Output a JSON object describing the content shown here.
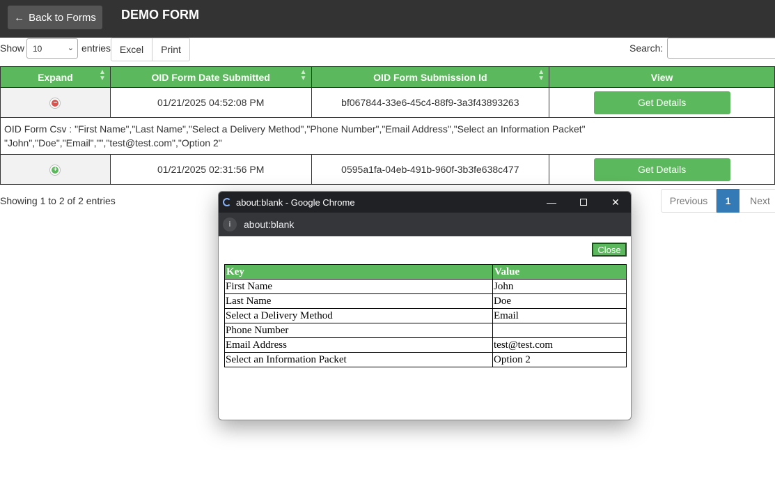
{
  "header": {
    "back_label": "Back to Forms",
    "title": "DEMO FORM"
  },
  "controls": {
    "show_label": "Show",
    "page_length": "10",
    "entries_label": "entries",
    "excel_label": "Excel",
    "print_label": "Print",
    "search_label": "Search:",
    "search_value": ""
  },
  "table": {
    "columns": [
      "Expand",
      "OID Form Date Submitted",
      "OID Form Submission Id",
      "View"
    ],
    "rows": [
      {
        "date": "01/21/2025 04:52:08 PM",
        "id": "bf067844-33e6-45c4-88f9-3a3f43893263",
        "button": "Get Details",
        "expanded": true,
        "csv_line1": "OID Form Csv : \"First Name\",\"Last Name\",\"Select a Delivery Method\",\"Phone Number\",\"Email Address\",\"Select an Information Packet\"",
        "csv_line2": "\"John\",\"Doe\",\"Email\",\"\",\"test@test.com\",\"Option 2\""
      },
      {
        "date": "01/21/2025 02:31:56 PM",
        "id": "0595a1fa-04eb-491b-960f-3b3fe638c477",
        "button": "Get Details",
        "expanded": false
      }
    ]
  },
  "footer": {
    "info": "Showing 1 to 2 of 2 entries",
    "prev_label": "Previous",
    "current_page": "1",
    "next_label": "Next"
  },
  "popup": {
    "window_title": "about:blank - Google Chrome",
    "address": "about:blank",
    "close_label": "Close",
    "headers": [
      "Key",
      "Value"
    ],
    "rows": [
      {
        "key": "First Name",
        "value": "John"
      },
      {
        "key": "Last Name",
        "value": "Doe"
      },
      {
        "key": "Select a Delivery Method",
        "value": "Email"
      },
      {
        "key": "Phone Number",
        "value": ""
      },
      {
        "key": "Email Address",
        "value": "test@test.com"
      },
      {
        "key": "Select an Information Packet",
        "value": "Option 2"
      }
    ]
  },
  "colors": {
    "accent_green": "#5cb85c",
    "header_dark": "#333333",
    "pager_blue": "#337ab7",
    "collapse_red": "#d9534f"
  }
}
